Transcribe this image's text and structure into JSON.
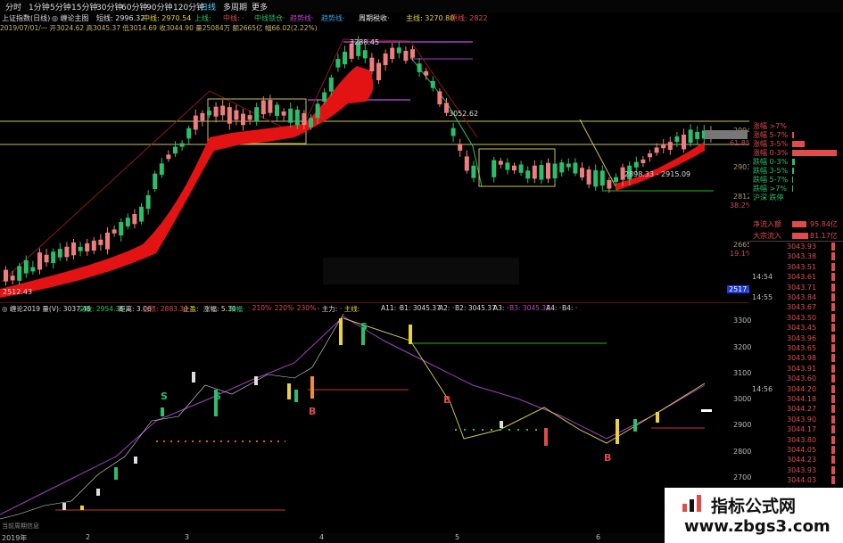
{
  "tabs": [
    "分时",
    "1分钟",
    "5分钟",
    "15分钟",
    "30分钟",
    "60分钟",
    "90分钟",
    "120分钟",
    "日线",
    "多周期",
    "更多"
  ],
  "info_bar": {
    "index": "上证指数(日线)",
    "indicator": "◎ 缠论主图",
    "items": [
      "短线: 2996.32",
      "中线: 2970.54",
      "上线:",
      "中线: ·",
      "中线锁仓·",
      "趋势线·",
      "趋势线·",
      "周期税收·"
    ],
    "right_items": [
      "主线: 3270.80",
      "原线: 2822"
    ]
  },
  "ohlc": "2019/07/01/一  开3024.62 高3045.37 低3014.69 收3044.90 量25084万 额2665亿 幅66.02(2.22%)",
  "upper_chart": {
    "price_labels": [
      "3288.45",
      "3052.62",
      "2898.33 - 2915.09",
      "2512.43"
    ],
    "right_ticks": [
      "2994",
      "61.8%",
      "2903",
      "2812",
      "38.2%",
      "2665",
      "19.1%",
      "2517.3"
    ],
    "right_tick_values": [
      2994,
      2903,
      2812,
      2665,
      2517.3
    ]
  },
  "right_panel": {
    "distribution": [
      {
        "label": "涨幅 >7%",
        "bar": 0
      },
      {
        "label": "涨幅 5-7%",
        "bar": 2
      },
      {
        "label": "涨幅 3-5%",
        "bar": 14
      },
      {
        "label": "涨幅 0-3%",
        "bar": 50
      },
      {
        "label": "跌幅 0-3%",
        "bar": 3
      },
      {
        "label": "跌幅 3-5%",
        "bar": 2
      },
      {
        "label": "跌幅 5-7%",
        "bar": 1
      },
      {
        "label": "跌幅 >7%",
        "bar": 1
      },
      {
        "label": "沪深 跌停",
        "bar": 0
      }
    ],
    "net_inflow_label": "净流入额",
    "net_inflow_value": "95.84亿",
    "big_inflow_label": "大宗流入",
    "big_inflow_value": "81.17亿",
    "times": [
      "14:54",
      "14:55",
      "14:56"
    ],
    "ticks": [
      {
        "time": "",
        "price": "3043.93"
      },
      {
        "time": "",
        "price": "3043.38"
      },
      {
        "time": "",
        "price": "3043.51"
      },
      {
        "time": "14:54",
        "price": "3043.61"
      },
      {
        "time": "",
        "price": "3043.71"
      },
      {
        "time": "14:55",
        "price": "3043.84"
      },
      {
        "time": "",
        "price": "3043.67"
      },
      {
        "time": "",
        "price": "3043.50"
      },
      {
        "time": "",
        "price": "3043.45"
      },
      {
        "time": "",
        "price": "3043.96"
      },
      {
        "time": "",
        "price": "3043.65"
      },
      {
        "time": "",
        "price": "3043.98"
      },
      {
        "time": "",
        "price": "3043.91"
      },
      {
        "time": "",
        "price": "3043.60"
      },
      {
        "time": "14:56",
        "price": "3044.20"
      },
      {
        "time": "",
        "price": "3044.18"
      },
      {
        "time": "",
        "price": "3044.27"
      },
      {
        "time": "",
        "price": "3043.90"
      },
      {
        "time": "",
        "price": "3044.17"
      },
      {
        "time": "",
        "price": "3043.80"
      },
      {
        "time": "",
        "price": "3044.05"
      },
      {
        "time": "",
        "price": "3044.23"
      },
      {
        "time": "",
        "price": "3043.93"
      },
      {
        "time": "",
        "price": "3044.03"
      }
    ]
  },
  "lower_bar": {
    "title": "◎ 缠论2019  量(V): 3037.46",
    "items": [
      "突破: 2954.36",
      "距离: 3.06",
      "止损: 2883.39",
      "止盈:",
      "涨幅: 5.30",
      "跌幅·",
      "·  210%",
      "·  220%",
      "·  230%",
      "·  主力:",
      "·  主线:",
      "A11: ·",
      "B1: 3045.37",
      "A2: ·",
      "B2: 3045.37",
      "A3: ·",
      "B3: 3045.37",
      "A4: ·",
      "B4: ·"
    ]
  },
  "lower_chart": {
    "right_ticks": [
      "3300",
      "3200",
      "3100",
      "3000",
      "2900",
      "2800",
      "2700"
    ],
    "x_labels": [
      "2019年",
      "2",
      "3",
      "4",
      "5",
      "6"
    ],
    "buy_sell_labels": [
      "S",
      "S",
      "S",
      "B",
      "B",
      "B"
    ],
    "bottom_note": "当前周期信息"
  },
  "watermark": {
    "line1": "指标公式网",
    "line2": "www.zbgs3.com"
  },
  "colors": {
    "up": "#e04b4b",
    "down": "#2bbf6b",
    "ma_band": "#e41313",
    "yellow": "#c9c25a",
    "purple": "#a33fc0",
    "green_line": "#28b828"
  }
}
